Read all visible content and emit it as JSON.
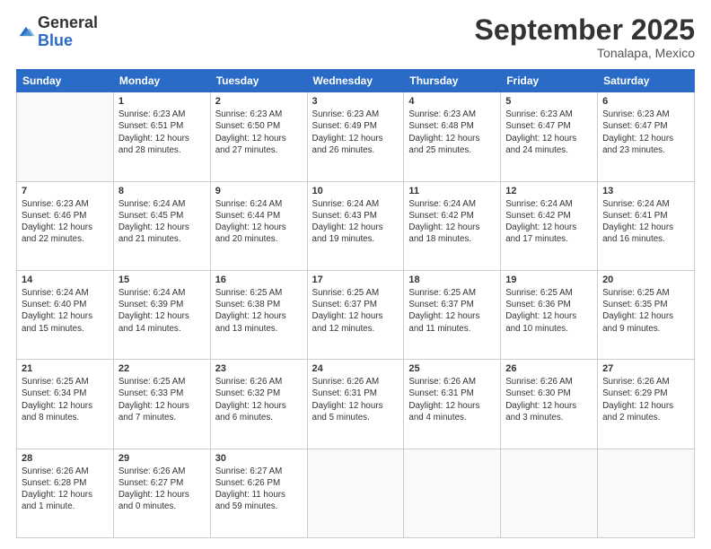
{
  "logo": {
    "general": "General",
    "blue": "Blue"
  },
  "header": {
    "month": "September 2025",
    "location": "Tonalapa, Mexico"
  },
  "weekdays": [
    "Sunday",
    "Monday",
    "Tuesday",
    "Wednesday",
    "Thursday",
    "Friday",
    "Saturday"
  ],
  "weeks": [
    [
      {
        "day": "",
        "info": ""
      },
      {
        "day": "1",
        "info": "Sunrise: 6:23 AM\nSunset: 6:51 PM\nDaylight: 12 hours\nand 28 minutes."
      },
      {
        "day": "2",
        "info": "Sunrise: 6:23 AM\nSunset: 6:50 PM\nDaylight: 12 hours\nand 27 minutes."
      },
      {
        "day": "3",
        "info": "Sunrise: 6:23 AM\nSunset: 6:49 PM\nDaylight: 12 hours\nand 26 minutes."
      },
      {
        "day": "4",
        "info": "Sunrise: 6:23 AM\nSunset: 6:48 PM\nDaylight: 12 hours\nand 25 minutes."
      },
      {
        "day": "5",
        "info": "Sunrise: 6:23 AM\nSunset: 6:47 PM\nDaylight: 12 hours\nand 24 minutes."
      },
      {
        "day": "6",
        "info": "Sunrise: 6:23 AM\nSunset: 6:47 PM\nDaylight: 12 hours\nand 23 minutes."
      }
    ],
    [
      {
        "day": "7",
        "info": "Sunrise: 6:23 AM\nSunset: 6:46 PM\nDaylight: 12 hours\nand 22 minutes."
      },
      {
        "day": "8",
        "info": "Sunrise: 6:24 AM\nSunset: 6:45 PM\nDaylight: 12 hours\nand 21 minutes."
      },
      {
        "day": "9",
        "info": "Sunrise: 6:24 AM\nSunset: 6:44 PM\nDaylight: 12 hours\nand 20 minutes."
      },
      {
        "day": "10",
        "info": "Sunrise: 6:24 AM\nSunset: 6:43 PM\nDaylight: 12 hours\nand 19 minutes."
      },
      {
        "day": "11",
        "info": "Sunrise: 6:24 AM\nSunset: 6:42 PM\nDaylight: 12 hours\nand 18 minutes."
      },
      {
        "day": "12",
        "info": "Sunrise: 6:24 AM\nSunset: 6:42 PM\nDaylight: 12 hours\nand 17 minutes."
      },
      {
        "day": "13",
        "info": "Sunrise: 6:24 AM\nSunset: 6:41 PM\nDaylight: 12 hours\nand 16 minutes."
      }
    ],
    [
      {
        "day": "14",
        "info": "Sunrise: 6:24 AM\nSunset: 6:40 PM\nDaylight: 12 hours\nand 15 minutes."
      },
      {
        "day": "15",
        "info": "Sunrise: 6:24 AM\nSunset: 6:39 PM\nDaylight: 12 hours\nand 14 minutes."
      },
      {
        "day": "16",
        "info": "Sunrise: 6:25 AM\nSunset: 6:38 PM\nDaylight: 12 hours\nand 13 minutes."
      },
      {
        "day": "17",
        "info": "Sunrise: 6:25 AM\nSunset: 6:37 PM\nDaylight: 12 hours\nand 12 minutes."
      },
      {
        "day": "18",
        "info": "Sunrise: 6:25 AM\nSunset: 6:37 PM\nDaylight: 12 hours\nand 11 minutes."
      },
      {
        "day": "19",
        "info": "Sunrise: 6:25 AM\nSunset: 6:36 PM\nDaylight: 12 hours\nand 10 minutes."
      },
      {
        "day": "20",
        "info": "Sunrise: 6:25 AM\nSunset: 6:35 PM\nDaylight: 12 hours\nand 9 minutes."
      }
    ],
    [
      {
        "day": "21",
        "info": "Sunrise: 6:25 AM\nSunset: 6:34 PM\nDaylight: 12 hours\nand 8 minutes."
      },
      {
        "day": "22",
        "info": "Sunrise: 6:25 AM\nSunset: 6:33 PM\nDaylight: 12 hours\nand 7 minutes."
      },
      {
        "day": "23",
        "info": "Sunrise: 6:26 AM\nSunset: 6:32 PM\nDaylight: 12 hours\nand 6 minutes."
      },
      {
        "day": "24",
        "info": "Sunrise: 6:26 AM\nSunset: 6:31 PM\nDaylight: 12 hours\nand 5 minutes."
      },
      {
        "day": "25",
        "info": "Sunrise: 6:26 AM\nSunset: 6:31 PM\nDaylight: 12 hours\nand 4 minutes."
      },
      {
        "day": "26",
        "info": "Sunrise: 6:26 AM\nSunset: 6:30 PM\nDaylight: 12 hours\nand 3 minutes."
      },
      {
        "day": "27",
        "info": "Sunrise: 6:26 AM\nSunset: 6:29 PM\nDaylight: 12 hours\nand 2 minutes."
      }
    ],
    [
      {
        "day": "28",
        "info": "Sunrise: 6:26 AM\nSunset: 6:28 PM\nDaylight: 12 hours\nand 1 minute."
      },
      {
        "day": "29",
        "info": "Sunrise: 6:26 AM\nSunset: 6:27 PM\nDaylight: 12 hours\nand 0 minutes."
      },
      {
        "day": "30",
        "info": "Sunrise: 6:27 AM\nSunset: 6:26 PM\nDaylight: 11 hours\nand 59 minutes."
      },
      {
        "day": "",
        "info": ""
      },
      {
        "day": "",
        "info": ""
      },
      {
        "day": "",
        "info": ""
      },
      {
        "day": "",
        "info": ""
      }
    ]
  ]
}
